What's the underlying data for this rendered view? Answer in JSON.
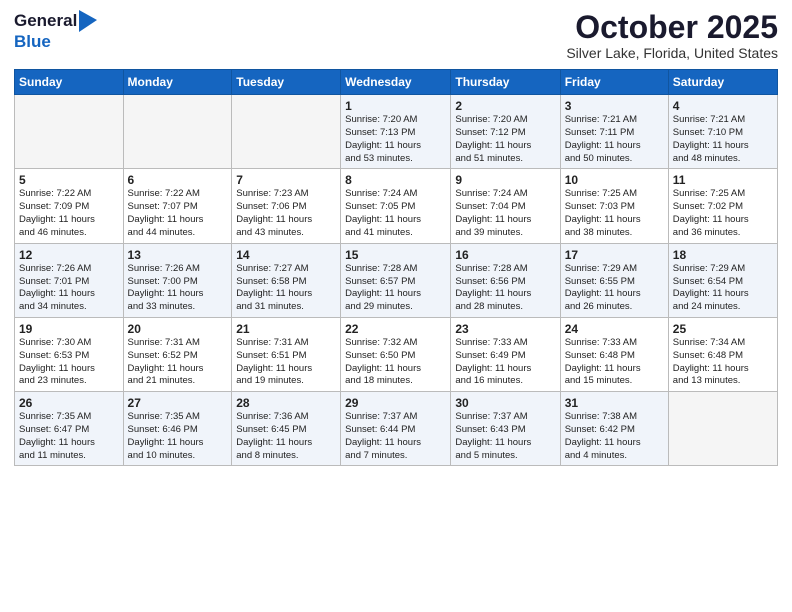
{
  "header": {
    "logo_general": "General",
    "logo_blue": "Blue",
    "month": "October 2025",
    "location": "Silver Lake, Florida, United States"
  },
  "weekdays": [
    "Sunday",
    "Monday",
    "Tuesday",
    "Wednesday",
    "Thursday",
    "Friday",
    "Saturday"
  ],
  "weeks": [
    [
      {
        "day": "",
        "info": ""
      },
      {
        "day": "",
        "info": ""
      },
      {
        "day": "",
        "info": ""
      },
      {
        "day": "1",
        "info": "Sunrise: 7:20 AM\nSunset: 7:13 PM\nDaylight: 11 hours\nand 53 minutes."
      },
      {
        "day": "2",
        "info": "Sunrise: 7:20 AM\nSunset: 7:12 PM\nDaylight: 11 hours\nand 51 minutes."
      },
      {
        "day": "3",
        "info": "Sunrise: 7:21 AM\nSunset: 7:11 PM\nDaylight: 11 hours\nand 50 minutes."
      },
      {
        "day": "4",
        "info": "Sunrise: 7:21 AM\nSunset: 7:10 PM\nDaylight: 11 hours\nand 48 minutes."
      }
    ],
    [
      {
        "day": "5",
        "info": "Sunrise: 7:22 AM\nSunset: 7:09 PM\nDaylight: 11 hours\nand 46 minutes."
      },
      {
        "day": "6",
        "info": "Sunrise: 7:22 AM\nSunset: 7:07 PM\nDaylight: 11 hours\nand 44 minutes."
      },
      {
        "day": "7",
        "info": "Sunrise: 7:23 AM\nSunset: 7:06 PM\nDaylight: 11 hours\nand 43 minutes."
      },
      {
        "day": "8",
        "info": "Sunrise: 7:24 AM\nSunset: 7:05 PM\nDaylight: 11 hours\nand 41 minutes."
      },
      {
        "day": "9",
        "info": "Sunrise: 7:24 AM\nSunset: 7:04 PM\nDaylight: 11 hours\nand 39 minutes."
      },
      {
        "day": "10",
        "info": "Sunrise: 7:25 AM\nSunset: 7:03 PM\nDaylight: 11 hours\nand 38 minutes."
      },
      {
        "day": "11",
        "info": "Sunrise: 7:25 AM\nSunset: 7:02 PM\nDaylight: 11 hours\nand 36 minutes."
      }
    ],
    [
      {
        "day": "12",
        "info": "Sunrise: 7:26 AM\nSunset: 7:01 PM\nDaylight: 11 hours\nand 34 minutes."
      },
      {
        "day": "13",
        "info": "Sunrise: 7:26 AM\nSunset: 7:00 PM\nDaylight: 11 hours\nand 33 minutes."
      },
      {
        "day": "14",
        "info": "Sunrise: 7:27 AM\nSunset: 6:58 PM\nDaylight: 11 hours\nand 31 minutes."
      },
      {
        "day": "15",
        "info": "Sunrise: 7:28 AM\nSunset: 6:57 PM\nDaylight: 11 hours\nand 29 minutes."
      },
      {
        "day": "16",
        "info": "Sunrise: 7:28 AM\nSunset: 6:56 PM\nDaylight: 11 hours\nand 28 minutes."
      },
      {
        "day": "17",
        "info": "Sunrise: 7:29 AM\nSunset: 6:55 PM\nDaylight: 11 hours\nand 26 minutes."
      },
      {
        "day": "18",
        "info": "Sunrise: 7:29 AM\nSunset: 6:54 PM\nDaylight: 11 hours\nand 24 minutes."
      }
    ],
    [
      {
        "day": "19",
        "info": "Sunrise: 7:30 AM\nSunset: 6:53 PM\nDaylight: 11 hours\nand 23 minutes."
      },
      {
        "day": "20",
        "info": "Sunrise: 7:31 AM\nSunset: 6:52 PM\nDaylight: 11 hours\nand 21 minutes."
      },
      {
        "day": "21",
        "info": "Sunrise: 7:31 AM\nSunset: 6:51 PM\nDaylight: 11 hours\nand 19 minutes."
      },
      {
        "day": "22",
        "info": "Sunrise: 7:32 AM\nSunset: 6:50 PM\nDaylight: 11 hours\nand 18 minutes."
      },
      {
        "day": "23",
        "info": "Sunrise: 7:33 AM\nSunset: 6:49 PM\nDaylight: 11 hours\nand 16 minutes."
      },
      {
        "day": "24",
        "info": "Sunrise: 7:33 AM\nSunset: 6:48 PM\nDaylight: 11 hours\nand 15 minutes."
      },
      {
        "day": "25",
        "info": "Sunrise: 7:34 AM\nSunset: 6:48 PM\nDaylight: 11 hours\nand 13 minutes."
      }
    ],
    [
      {
        "day": "26",
        "info": "Sunrise: 7:35 AM\nSunset: 6:47 PM\nDaylight: 11 hours\nand 11 minutes."
      },
      {
        "day": "27",
        "info": "Sunrise: 7:35 AM\nSunset: 6:46 PM\nDaylight: 11 hours\nand 10 minutes."
      },
      {
        "day": "28",
        "info": "Sunrise: 7:36 AM\nSunset: 6:45 PM\nDaylight: 11 hours\nand 8 minutes."
      },
      {
        "day": "29",
        "info": "Sunrise: 7:37 AM\nSunset: 6:44 PM\nDaylight: 11 hours\nand 7 minutes."
      },
      {
        "day": "30",
        "info": "Sunrise: 7:37 AM\nSunset: 6:43 PM\nDaylight: 11 hours\nand 5 minutes."
      },
      {
        "day": "31",
        "info": "Sunrise: 7:38 AM\nSunset: 6:42 PM\nDaylight: 11 hours\nand 4 minutes."
      },
      {
        "day": "",
        "info": ""
      }
    ]
  ]
}
